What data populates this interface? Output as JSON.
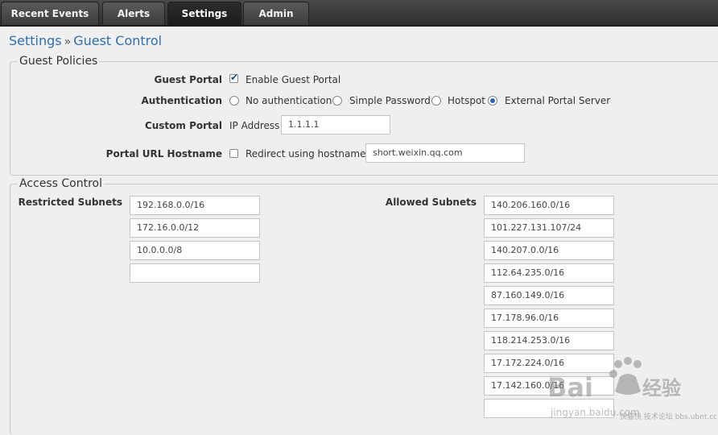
{
  "tabs": [
    {
      "label": "Recent Events"
    },
    {
      "label": "Alerts"
    },
    {
      "label": "Settings"
    },
    {
      "label": "Admin"
    }
  ],
  "breadcrumb": {
    "parent": "Settings",
    "separator": "»",
    "current": "Guest Control"
  },
  "guest_policies": {
    "legend": "Guest Policies",
    "guest_portal": {
      "label": "Guest Portal",
      "checkbox_label": "Enable Guest Portal",
      "checked": true
    },
    "authentication": {
      "label": "Authentication",
      "options": [
        "No authentication",
        "Simple Password",
        "Hotspot",
        "External Portal Server"
      ],
      "selected": "External Portal Server"
    },
    "custom_portal": {
      "label": "Custom Portal",
      "field_label": "IP Address",
      "value": "1.1.1.1"
    },
    "portal_url_hostname": {
      "label": "Portal URL Hostname",
      "checkbox_label": "Redirect using hostname",
      "checked": false,
      "value": "short.weixin.qq.com"
    }
  },
  "access_control": {
    "legend": "Access Control",
    "restricted": {
      "label": "Restricted Subnets",
      "values": [
        "192.168.0.0/16",
        "172.16.0.0/12",
        "10.0.0.0/8",
        ""
      ]
    },
    "allowed": {
      "label": "Allowed Subnets",
      "values": [
        "140.206.160.0/16",
        "101.227.131.107/24",
        "140.207.0.0/16",
        "112.64.235.0/16",
        "87.160.149.0/16",
        "17.178.96.0/16",
        "118.214.253.0/16",
        "17.172.224.0/16",
        "17.142.160.0/16",
        ""
      ]
    }
  },
  "watermark": {
    "brand": "Bai",
    "brand_cn": "经验",
    "site": "jingyan.baidu.com",
    "site2": "快猫快 技术论坛 bbs.ubnt.com.cn"
  },
  "colors": {
    "link": "#2f6fb0",
    "tabbar": "#2e2e2e",
    "background": "#efefef"
  }
}
